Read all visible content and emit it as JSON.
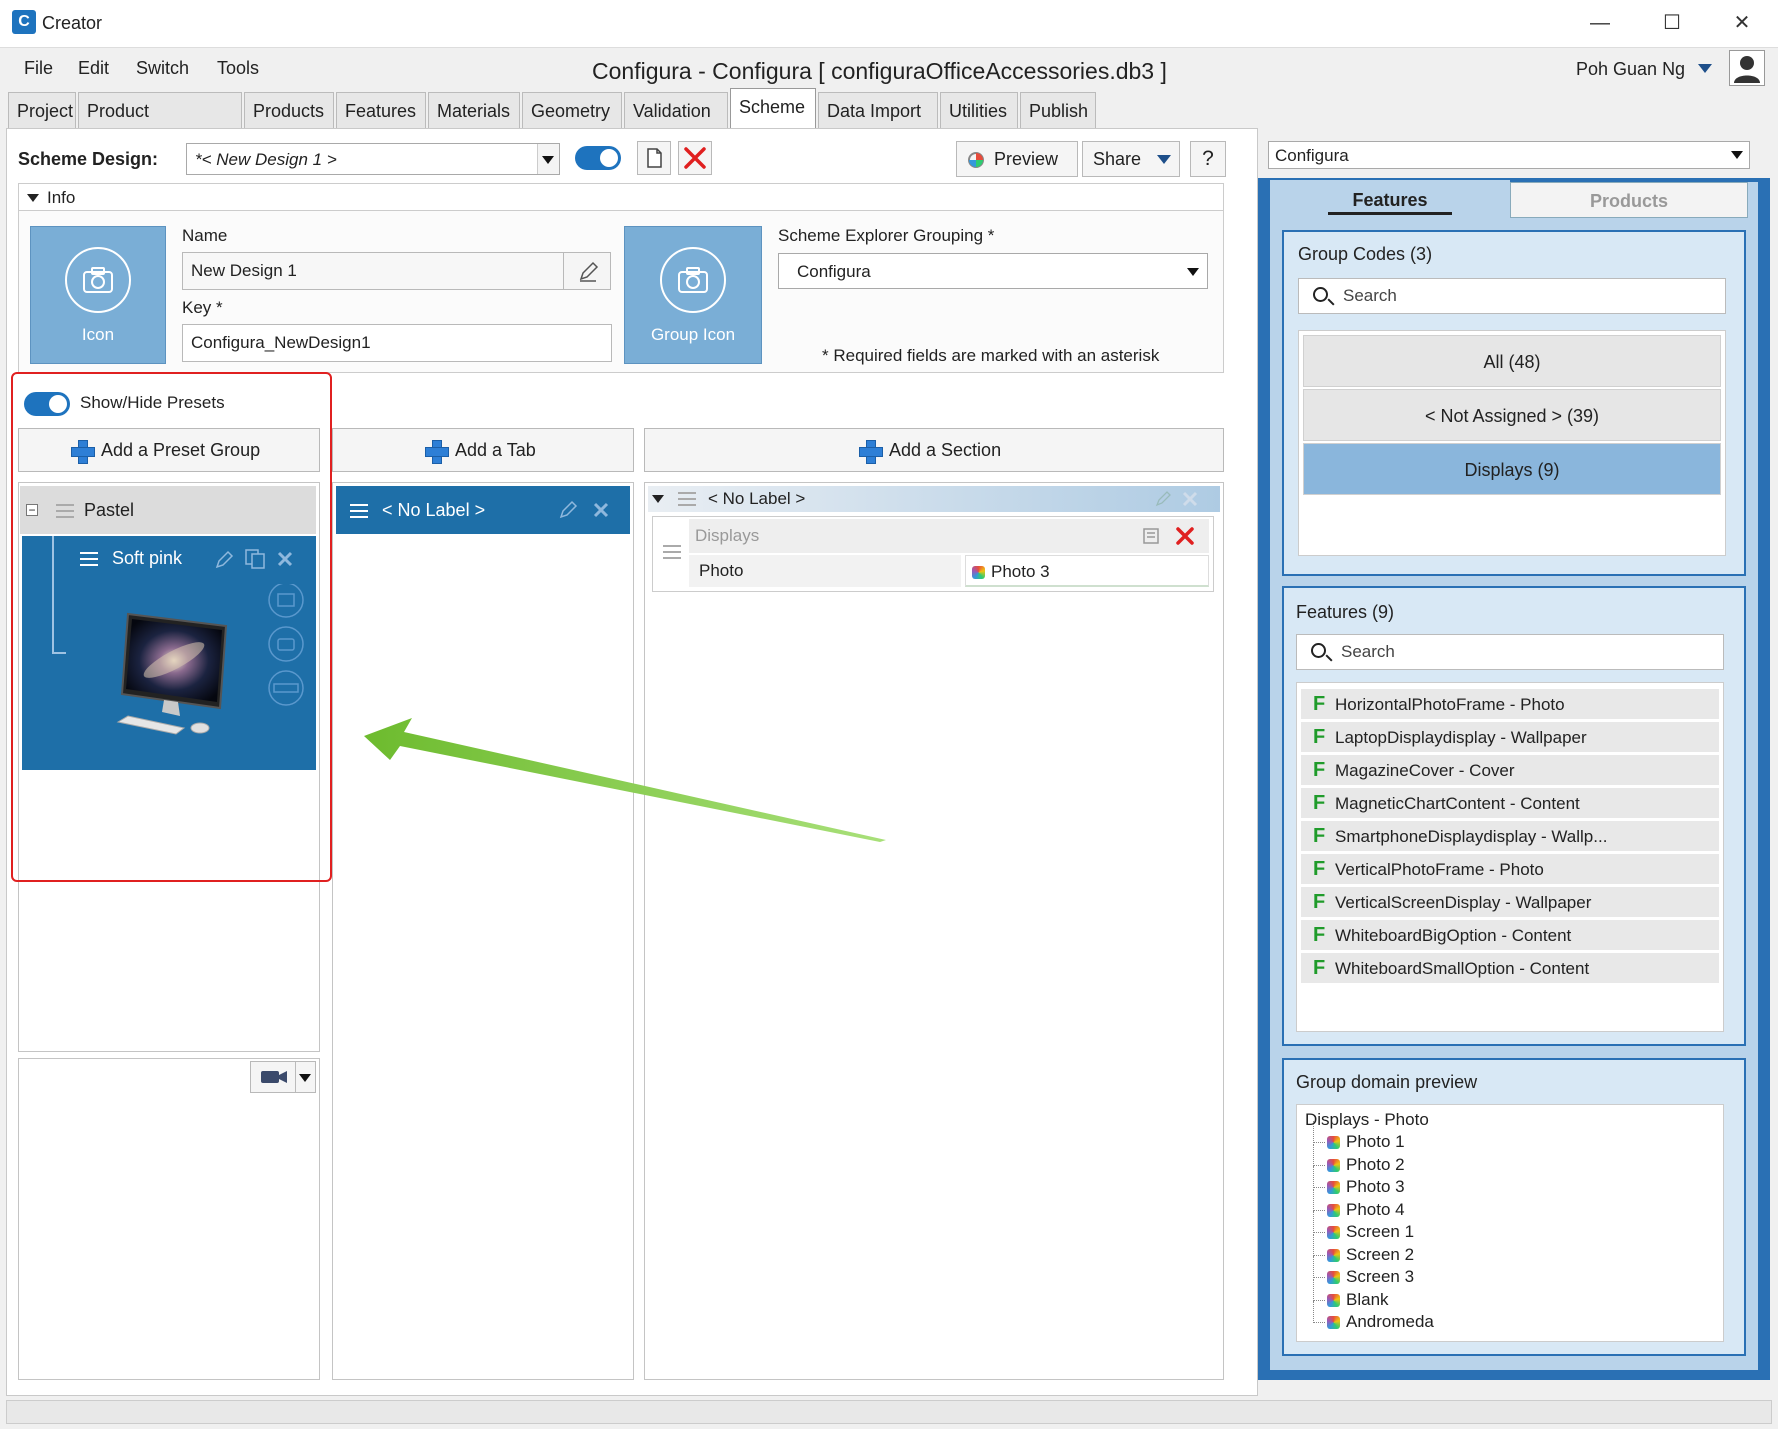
{
  "window": {
    "app_title": "Creator",
    "logo_letter": "C",
    "document_title": "Configura - Configura [ configuraOfficeAccessories.db3 ]",
    "minimize": "—",
    "maximize": "☐",
    "close": "✕"
  },
  "menu": {
    "file": "File",
    "edit": "Edit",
    "switch": "Switch",
    "tools": "Tools"
  },
  "user": {
    "name": "Poh Guan Ng"
  },
  "tabs": [
    "Project",
    "Product Catalogues",
    "Products",
    "Features",
    "Materials",
    "Geometry",
    "Validation",
    "Scheme",
    "Data Import",
    "Utilities",
    "Publish"
  ],
  "active_tab": "Scheme",
  "scheme": {
    "label": "Scheme Design:",
    "design_value": "*< New Design 1 >",
    "preview_label": "Preview",
    "share_label": "Share",
    "help_label": "?"
  },
  "info": {
    "header": "Info",
    "icon_label": "Icon",
    "name_label": "Name",
    "name_value": "New Design 1",
    "key_label": "Key *",
    "key_value": "Configura_NewDesign1",
    "group_icon_label": "Group Icon",
    "grouping_label": "Scheme Explorer Grouping *",
    "grouping_value": "Configura",
    "required_note": "* Required fields are marked with an asterisk"
  },
  "presets": {
    "toggle_label": "Show/Hide Presets",
    "add_preset_group": "Add a Preset Group",
    "add_tab": "Add a Tab",
    "add_section": "Add a Section",
    "group_name": "Pastel",
    "preset_name": "Soft pink",
    "tab_label": "< No Label >",
    "section_label": "< No Label >",
    "section_group": "Displays",
    "row_label": "Photo",
    "row_value": "Photo 3"
  },
  "right": {
    "catalogue_value": "Configura",
    "tab_features": "Features",
    "tab_products": "Products",
    "group_codes_title": "Group Codes (3)",
    "search_placeholder": "Search",
    "group_codes": [
      "All (48)",
      "< Not Assigned > (39)",
      "Displays (9)"
    ],
    "features_title": "Features (9)",
    "features": [
      "HorizontalPhotoFrame - Photo",
      "LaptopDisplaydisplay - Wallpaper",
      "MagazineCover - Cover",
      "MagneticChartContent - Content",
      "SmartphoneDisplaydisplay - Wallp...",
      "VerticalPhotoFrame - Photo",
      "VerticalScreenDisplay - Wallpaper",
      "WhiteboardBigOption - Content",
      "WhiteboardSmallOption - Content"
    ],
    "feature_letter": "F",
    "preview_title": "Group domain preview",
    "tree_root": "Displays - Photo",
    "tree_items": [
      "Photo 1",
      "Photo 2",
      "Photo 3",
      "Photo 4",
      "Screen 1",
      "Screen 2",
      "Screen 3",
      "Blank",
      "Andromeda"
    ]
  },
  "colors": {
    "accent": "#1e73be",
    "selected_blue": "#1e6fa8",
    "highlight_red": "#e02020",
    "arrow_green": "#7dc242",
    "right_panel_blue": "#2a70b4"
  }
}
